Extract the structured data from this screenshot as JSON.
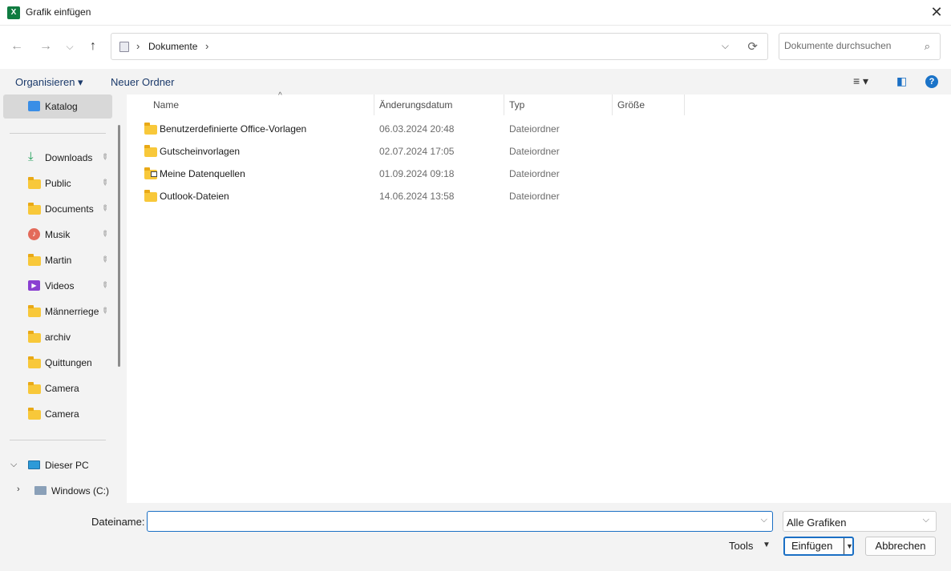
{
  "window": {
    "title": "Grafik einfügen",
    "close_glyph": "✕"
  },
  "nav": {
    "back_glyph": "←",
    "forward_glyph": "→",
    "recent_glyph": "⌵",
    "up_glyph": "↑"
  },
  "address": {
    "crumb": "Dokumente",
    "separator": "›",
    "dropdown_glyph": "⌵",
    "refresh_glyph": "⟳"
  },
  "search": {
    "placeholder": "Dokumente durchsuchen",
    "icon_glyph": "⌕"
  },
  "toolbar": {
    "organize_label": "Organisieren ▾",
    "new_folder_label": "Neuer Ordner",
    "view_glyph": "≡ ▾",
    "preview_glyph": "◧",
    "help_glyph": "?"
  },
  "sidebar": {
    "gallery_label": "Katalog",
    "quick_access": [
      {
        "label": "Downloads",
        "icon": "download-icon"
      },
      {
        "label": "Public",
        "icon": "folder-icon"
      },
      {
        "label": "Documents",
        "icon": "folder-icon"
      },
      {
        "label": "Musik",
        "icon": "music-icon"
      },
      {
        "label": "Martin",
        "icon": "folder-icon"
      },
      {
        "label": "Videos",
        "icon": "video-icon"
      },
      {
        "label": "Männerriege",
        "icon": "folder-icon"
      },
      {
        "label": "archiv",
        "icon": "folder-icon"
      },
      {
        "label": "Quittungen",
        "icon": "folder-icon"
      },
      {
        "label": "Camera",
        "icon": "folder-icon"
      },
      {
        "label": "Camera",
        "icon": "folder-icon"
      }
    ],
    "pin_glyph": "📌",
    "this_pc_label": "Dieser PC",
    "drive_label": "Windows (C:)"
  },
  "columns": {
    "name": "Name",
    "date": "Änderungsdatum",
    "type": "Typ",
    "size": "Größe",
    "sort_glyph": "^"
  },
  "files": [
    {
      "name": "Benutzerdefinierte Office-Vorlagen",
      "date": "06.03.2024 20:48",
      "type": "Dateiordner"
    },
    {
      "name": "Gutscheinvorlagen",
      "date": "02.07.2024 17:05",
      "type": "Dateiordner"
    },
    {
      "name": "Meine Datenquellen",
      "date": "01.09.2024 09:18",
      "type": "Dateiordner"
    },
    {
      "name": "Outlook-Dateien",
      "date": "14.06.2024 13:58",
      "type": "Dateiordner"
    }
  ],
  "footer": {
    "filename_label": "Dateiname:",
    "filename_value": "",
    "filter_value": "Alle Grafiken",
    "dropdown_glyph": "⌵",
    "tools_label": "Tools",
    "tools_dd_glyph": "▼",
    "insert_label": "Einfügen",
    "insert_dd_glyph": "▼",
    "cancel_label": "Abbrechen"
  },
  "colors": {
    "accent": "#1a6fc4",
    "folder": "#f8c83a",
    "excel": "#107c41"
  }
}
